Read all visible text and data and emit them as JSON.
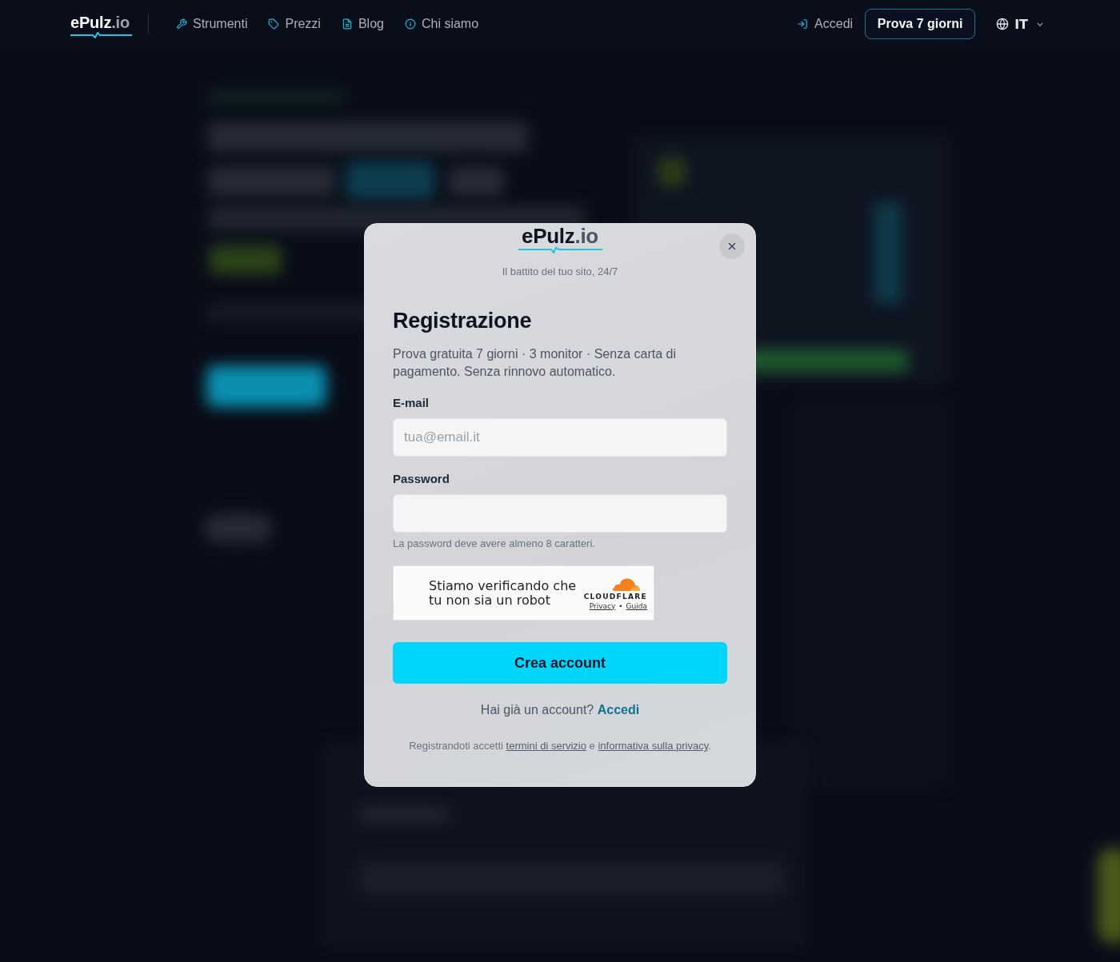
{
  "nav": {
    "logo": {
      "name": "ePulz",
      "suffix": ".io"
    },
    "links": [
      {
        "label": "Strumenti"
      },
      {
        "label": "Prezzi"
      },
      {
        "label": "Blog"
      },
      {
        "label": "Chi siamo"
      }
    ],
    "login": "Accedi",
    "trial_button": "Prova 7 giorni",
    "language": "IT"
  },
  "modal": {
    "logo": {
      "name": "ePulz",
      "suffix": ".io"
    },
    "tagline": "Il battito del tuo sito, 24/7",
    "title": "Registrazione",
    "description": "Prova gratuita 7 giorni · 3 monitor · Senza carta di pagamento. Senza rinnovo automatico.",
    "fields": [
      {
        "label": "E-mail",
        "placeholder": "tua@email.it"
      },
      {
        "label": "Password",
        "hint": "La password deve avere almeno 8 caratteri."
      }
    ],
    "captcha": {
      "message": "Stiamo verificando che tu non sia un robot",
      "brand": "CLOUDFLARE",
      "links": [
        "Privacy",
        "Guida"
      ],
      "separator": "•"
    },
    "submit": "Crea account",
    "login_prompt": {
      "text": "Hai già un account?",
      "link": "Accedi"
    },
    "legal": {
      "before": "Registrandoti accetti",
      "terms": "termini di servizio",
      "joiner": "e",
      "privacy": "informativa sulla privacy",
      "end": "."
    }
  }
}
